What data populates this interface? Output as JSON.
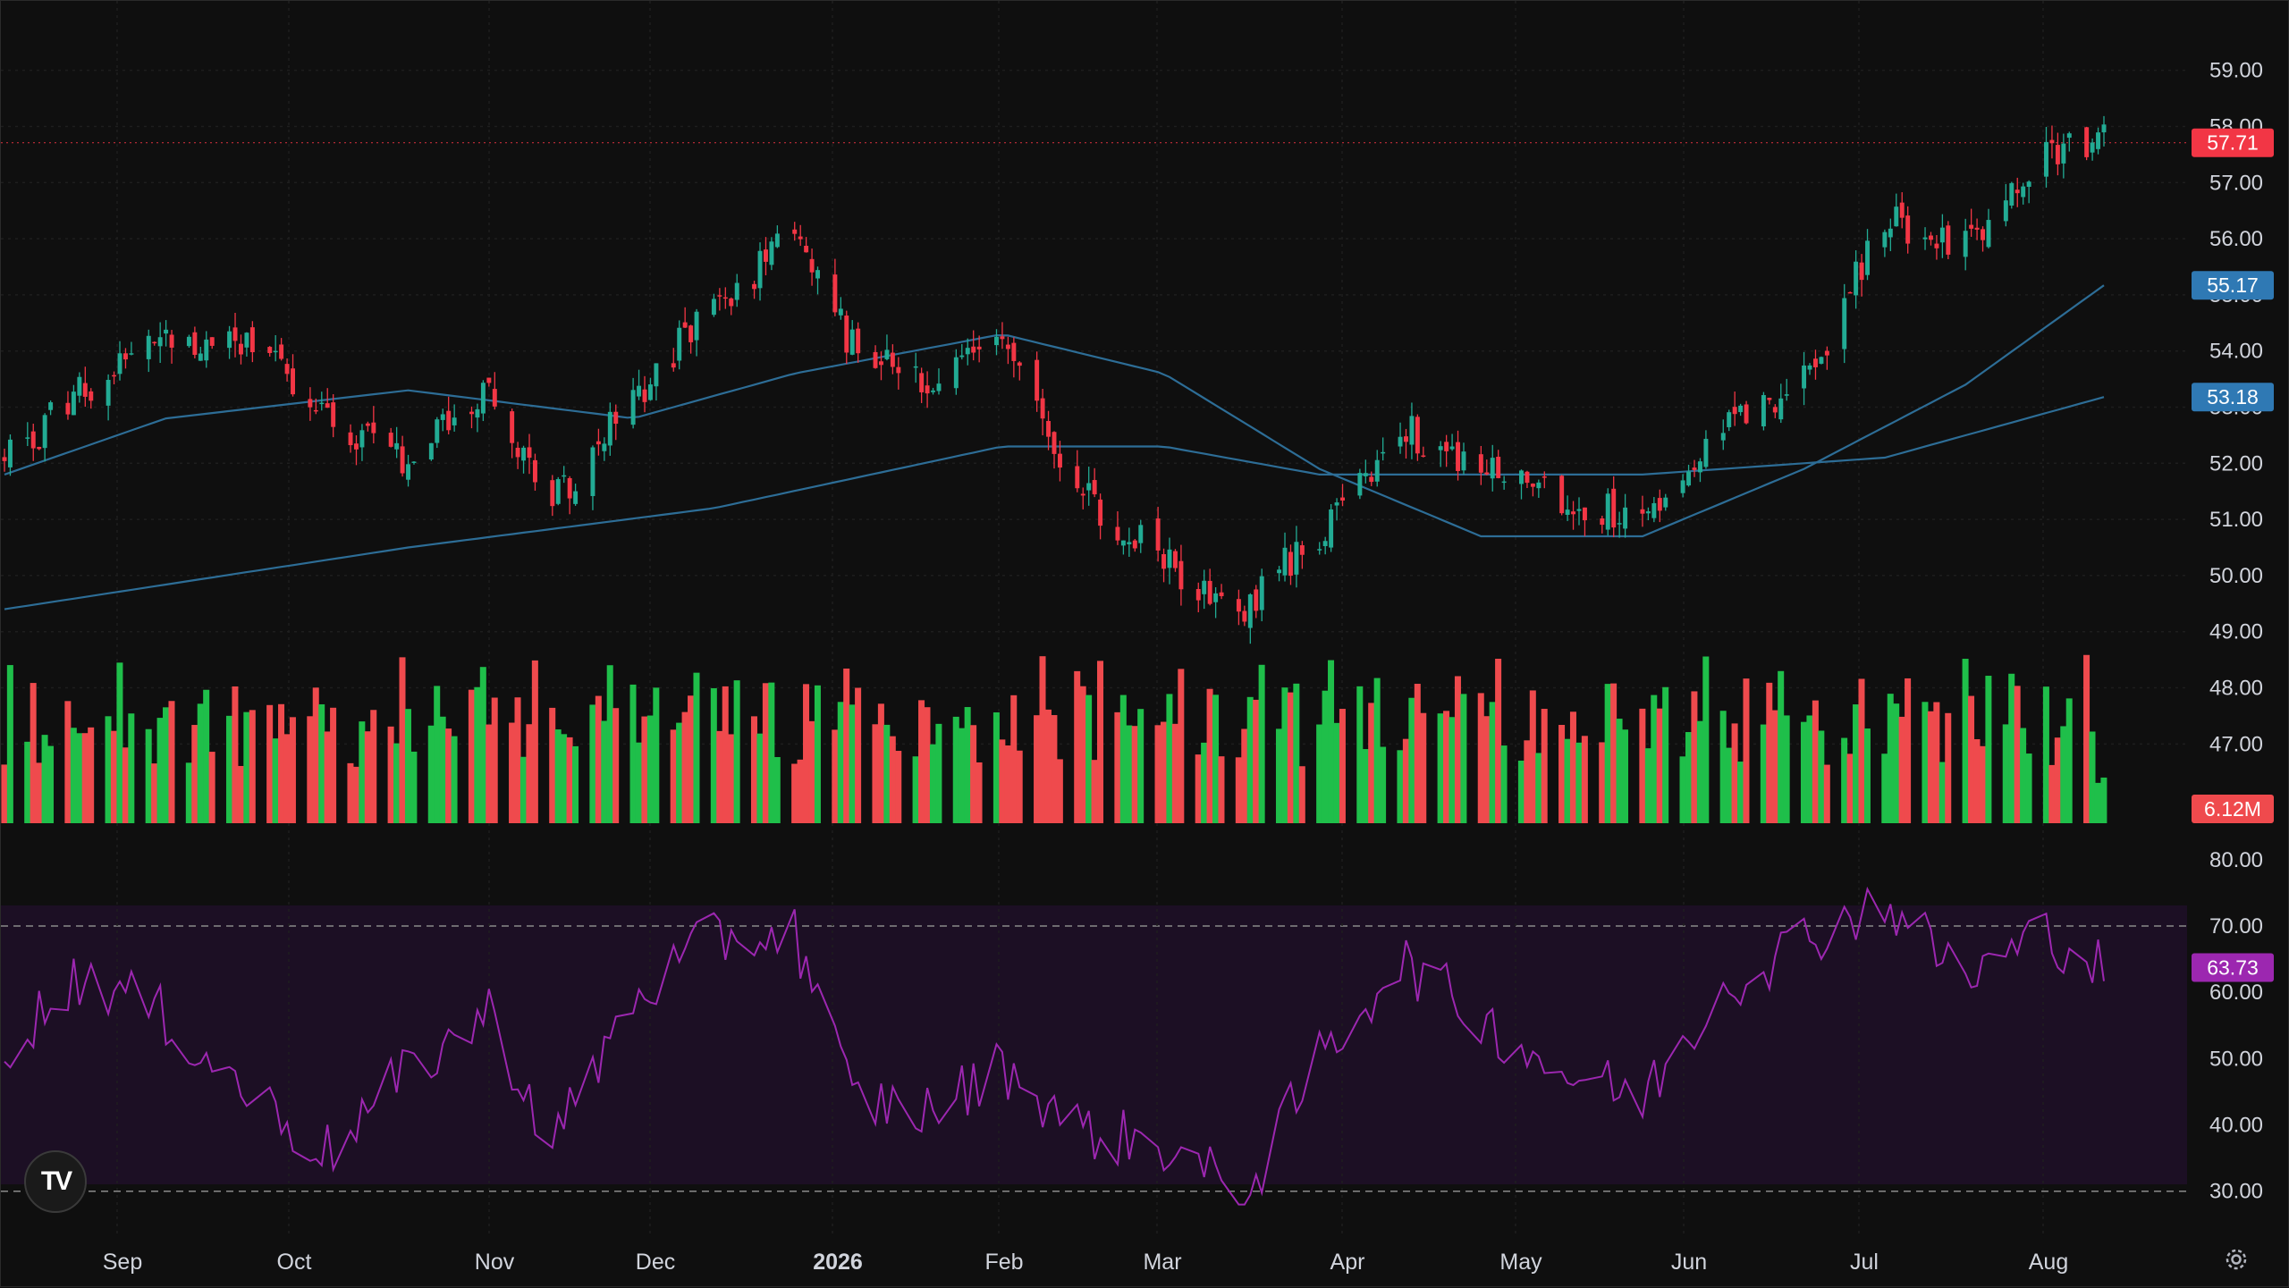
{
  "app": {
    "logo_text": "TV",
    "settings_icon": "gear-icon"
  },
  "colors": {
    "background": "#0f0f0f",
    "up": "#22ab94",
    "down": "#f23645",
    "volume_up": "#1fbf4a",
    "volume_down": "#ef4a4d",
    "ma": "#2d6d96",
    "rsi_line": "#9c27b0",
    "rsi_band": "#1c0f24",
    "last_price": "#f23645",
    "ma50_badge": "#2f79b4",
    "ma200_badge": "#2f79b4",
    "rsi_badge": "#9c27b0"
  },
  "chart_data": {
    "type": "candlestick",
    "x_axis": {
      "labels": [
        "Sep",
        "Oct",
        "Nov",
        "Dec",
        "2026",
        "Feb",
        "Mar",
        "Apr",
        "May",
        "Jun",
        "Jul",
        "Aug"
      ],
      "bold_labels": [
        "2026"
      ]
    },
    "price_panel": {
      "ylim": [
        48.9,
        59.6
      ],
      "y_ticks": [
        "59.00",
        "58.00",
        "57.00",
        "56.00",
        "55.00",
        "54.00",
        "53.00",
        "52.00",
        "51.00",
        "50.00",
        "49.00",
        "48.00",
        "47.00"
      ],
      "last_price": "57.71",
      "moving_average_badges": [
        "55.17",
        "53.18"
      ],
      "close_path": [
        {
          "date": "2025-08-21",
          "close": 52.0
        },
        {
          "date": "2025-09-04",
          "close": 53.4
        },
        {
          "date": "2025-09-18",
          "close": 54.1
        },
        {
          "date": "2025-10-02",
          "close": 54.2
        },
        {
          "date": "2025-10-16",
          "close": 52.8
        },
        {
          "date": "2025-10-30",
          "close": 52.1
        },
        {
          "date": "2025-11-13",
          "close": 53.4
        },
        {
          "date": "2025-11-24",
          "close": 51.3
        },
        {
          "date": "2025-12-08",
          "close": 53.2
        },
        {
          "date": "2025-12-22",
          "close": 54.8
        },
        {
          "date": "2026-01-05",
          "close": 56.0
        },
        {
          "date": "2026-01-15",
          "close": 54.1
        },
        {
          "date": "2026-01-29",
          "close": 53.5
        },
        {
          "date": "2026-02-10",
          "close": 54.2
        },
        {
          "date": "2026-02-24",
          "close": 51.5
        },
        {
          "date": "2026-03-10",
          "close": 50.2
        },
        {
          "date": "2026-03-24",
          "close": 49.5
        },
        {
          "date": "2026-04-06",
          "close": 50.8
        },
        {
          "date": "2026-04-20",
          "close": 52.6
        },
        {
          "date": "2026-05-04",
          "close": 51.9
        },
        {
          "date": "2026-05-18",
          "close": 51.3
        },
        {
          "date": "2026-06-01",
          "close": 51.1
        },
        {
          "date": "2026-06-15",
          "close": 52.8
        },
        {
          "date": "2026-06-29",
          "close": 53.4
        },
        {
          "date": "2026-07-13",
          "close": 56.3
        },
        {
          "date": "2026-07-27",
          "close": 56.0
        },
        {
          "date": "2026-08-10",
          "close": 57.5
        },
        {
          "date": "2026-08-20",
          "close": 57.71
        }
      ],
      "ma_fast": [
        {
          "date": "2025-08-21",
          "value": 51.8
        },
        {
          "date": "2025-09-18",
          "value": 52.8
        },
        {
          "date": "2025-10-30",
          "value": 53.3
        },
        {
          "date": "2025-12-08",
          "value": 52.8
        },
        {
          "date": "2026-01-05",
          "value": 53.6
        },
        {
          "date": "2026-02-10",
          "value": 54.3
        },
        {
          "date": "2026-03-10",
          "value": 53.6
        },
        {
          "date": "2026-04-06",
          "value": 51.9
        },
        {
          "date": "2026-05-04",
          "value": 50.7
        },
        {
          "date": "2026-06-01",
          "value": 50.7
        },
        {
          "date": "2026-06-29",
          "value": 51.9
        },
        {
          "date": "2026-07-27",
          "value": 53.4
        },
        {
          "date": "2026-08-20",
          "value": 55.17
        }
      ],
      "ma_slow": [
        {
          "date": "2025-08-21",
          "value": 49.4
        },
        {
          "date": "2025-10-30",
          "value": 50.5
        },
        {
          "date": "2025-12-22",
          "value": 51.2
        },
        {
          "date": "2026-02-10",
          "value": 52.3
        },
        {
          "date": "2026-03-10",
          "value": 52.3
        },
        {
          "date": "2026-04-06",
          "value": 51.8
        },
        {
          "date": "2026-06-01",
          "value": 51.8
        },
        {
          "date": "2026-07-13",
          "value": 52.1
        },
        {
          "date": "2026-08-20",
          "value": 53.18
        }
      ]
    },
    "volume_panel": {
      "last_volume": "6.12M"
    },
    "rsi_panel": {
      "ylim": [
        27,
        82
      ],
      "y_ticks": [
        "80.00",
        "70.00",
        "60.00",
        "50.00",
        "40.00",
        "30.00"
      ],
      "overbought": 70,
      "oversold": 30,
      "last_value": "63.73",
      "path": [
        {
          "date": "2025-08-21",
          "value": 52
        },
        {
          "date": "2025-09-04",
          "value": 63
        },
        {
          "date": "2025-09-18",
          "value": 56
        },
        {
          "date": "2025-10-02",
          "value": 45
        },
        {
          "date": "2025-10-16",
          "value": 36
        },
        {
          "date": "2025-10-30",
          "value": 48
        },
        {
          "date": "2025-11-13",
          "value": 57
        },
        {
          "date": "2025-11-24",
          "value": 37
        },
        {
          "date": "2025-12-08",
          "value": 59
        },
        {
          "date": "2025-12-22",
          "value": 68
        },
        {
          "date": "2026-01-05",
          "value": 69
        },
        {
          "date": "2026-01-15",
          "value": 44
        },
        {
          "date": "2026-01-29",
          "value": 42
        },
        {
          "date": "2026-02-10",
          "value": 49
        },
        {
          "date": "2026-02-24",
          "value": 39
        },
        {
          "date": "2026-03-10",
          "value": 37
        },
        {
          "date": "2026-03-24",
          "value": 29
        },
        {
          "date": "2026-04-06",
          "value": 50
        },
        {
          "date": "2026-04-20",
          "value": 65
        },
        {
          "date": "2026-05-04",
          "value": 56
        },
        {
          "date": "2026-05-18",
          "value": 48
        },
        {
          "date": "2026-06-01",
          "value": 44
        },
        {
          "date": "2026-06-15",
          "value": 61
        },
        {
          "date": "2026-06-29",
          "value": 68
        },
        {
          "date": "2026-07-13",
          "value": 74
        },
        {
          "date": "2026-07-27",
          "value": 62
        },
        {
          "date": "2026-08-10",
          "value": 69
        },
        {
          "date": "2026-08-20",
          "value": 63.73
        }
      ]
    },
    "grid": true,
    "crosshair_line_at": "57.71"
  }
}
